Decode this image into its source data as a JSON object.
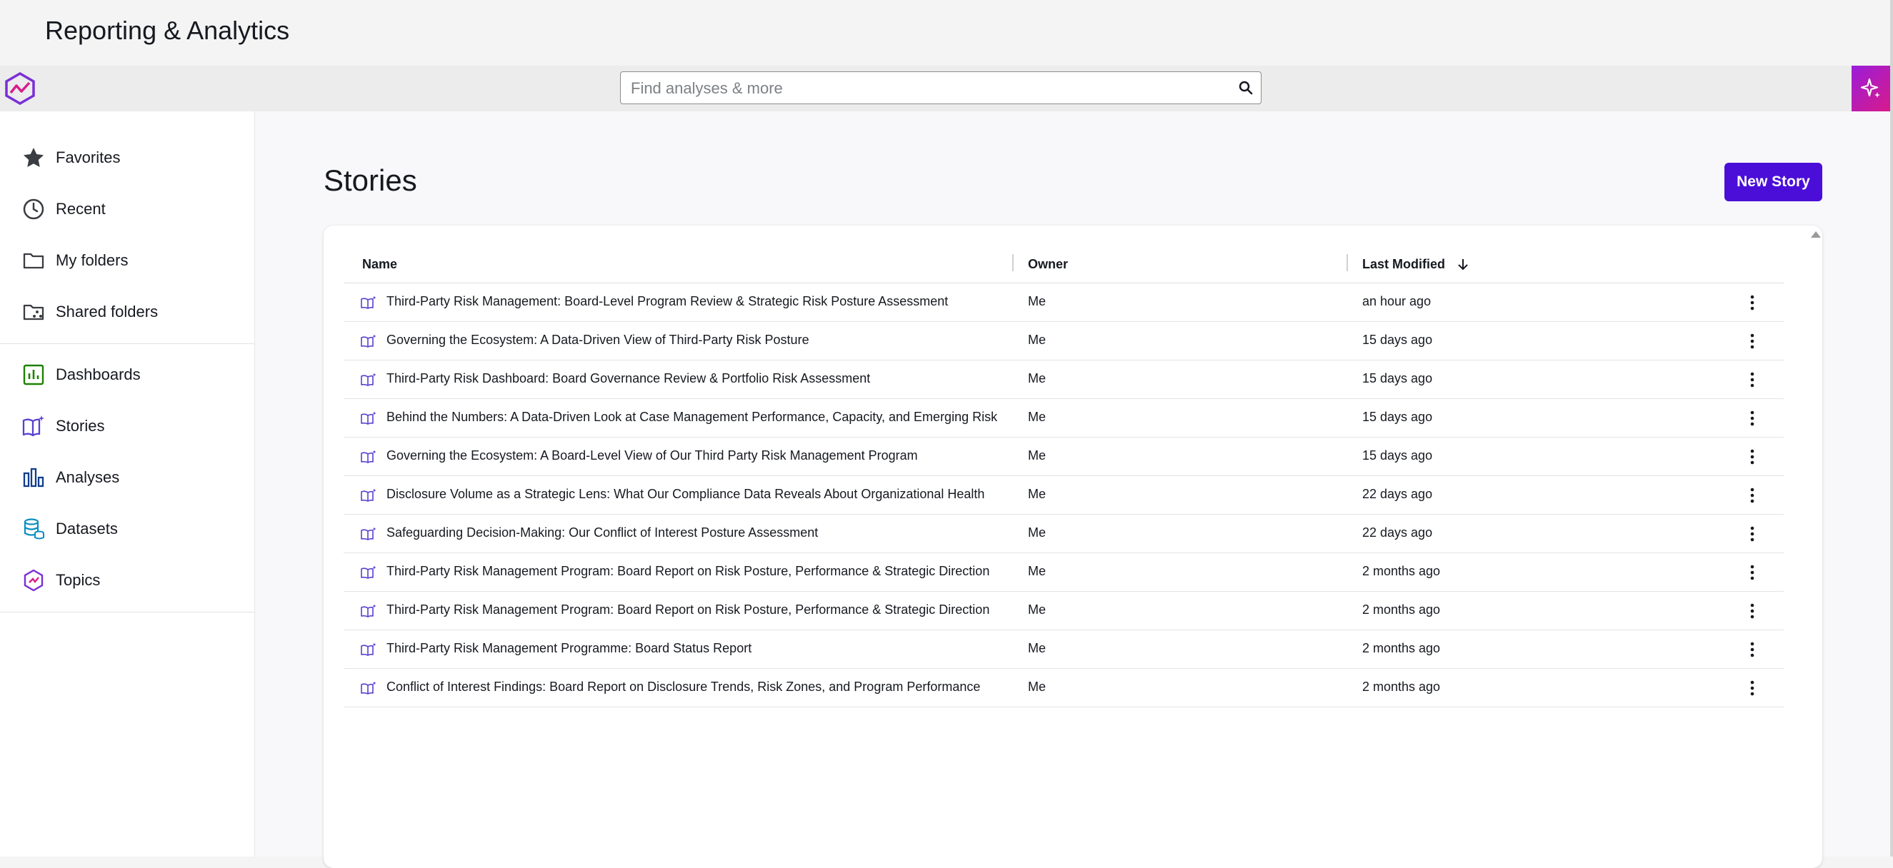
{
  "app": {
    "title": "Reporting & Analytics"
  },
  "search": {
    "placeholder": "Find analyses & more"
  },
  "sidebar": {
    "items": [
      {
        "label": "Favorites",
        "icon": "star-icon"
      },
      {
        "label": "Recent",
        "icon": "clock-icon"
      },
      {
        "label": "My folders",
        "icon": "folder-icon"
      },
      {
        "label": "Shared folders",
        "icon": "shared-folder-icon"
      },
      {
        "label": "Dashboards",
        "icon": "dashboard-icon"
      },
      {
        "label": "Stories",
        "icon": "story-icon"
      },
      {
        "label": "Analyses",
        "icon": "analyses-icon"
      },
      {
        "label": "Datasets",
        "icon": "dataset-icon"
      },
      {
        "label": "Topics",
        "icon": "topic-icon"
      }
    ]
  },
  "page": {
    "title": "Stories",
    "new_button": "New Story"
  },
  "table": {
    "columns": {
      "name": "Name",
      "owner": "Owner",
      "modified": "Last Modified"
    },
    "rows": [
      {
        "name": "Third-Party Risk Management: Board-Level Program Review & Strategic Risk Posture Assessment",
        "owner": "Me",
        "modified": "an hour ago"
      },
      {
        "name": "Governing the Ecosystem: A Data-Driven View of Third-Party Risk Posture",
        "owner": "Me",
        "modified": "15 days ago"
      },
      {
        "name": "Third-Party Risk Dashboard: Board Governance Review & Portfolio Risk Assessment",
        "owner": "Me",
        "modified": "15 days ago"
      },
      {
        "name": "Behind the Numbers: A Data-Driven Look at Case Management Performance, Capacity, and Emerging Risk",
        "owner": "Me",
        "modified": "15 days ago"
      },
      {
        "name": "Governing the Ecosystem: A Board-Level View of Our Third Party Risk Management Program",
        "owner": "Me",
        "modified": "15 days ago"
      },
      {
        "name": "Disclosure Volume as a Strategic Lens: What Our Compliance Data Reveals About Organizational Health",
        "owner": "Me",
        "modified": "22 days ago"
      },
      {
        "name": "Safeguarding Decision-Making: Our Conflict of Interest Posture Assessment",
        "owner": "Me",
        "modified": "22 days ago"
      },
      {
        "name": "Third-Party Risk Management Program: Board Report on Risk Posture, Performance & Strategic Direction",
        "owner": "Me",
        "modified": "2 months ago"
      },
      {
        "name": "Third-Party Risk Management Program: Board Report on Risk Posture, Performance & Strategic Direction",
        "owner": "Me",
        "modified": "2 months ago"
      },
      {
        "name": "Third-Party Risk Management Programme: Board Status Report",
        "owner": "Me",
        "modified": "2 months ago"
      },
      {
        "name": "Conflict of Interest Findings: Board Report on Disclosure Trends, Risk Zones, and Program Performance",
        "owner": "Me",
        "modified": "2 months ago"
      }
    ]
  },
  "colors": {
    "accent": "#4b0ed8",
    "story_icon": "#5a3fd1"
  }
}
